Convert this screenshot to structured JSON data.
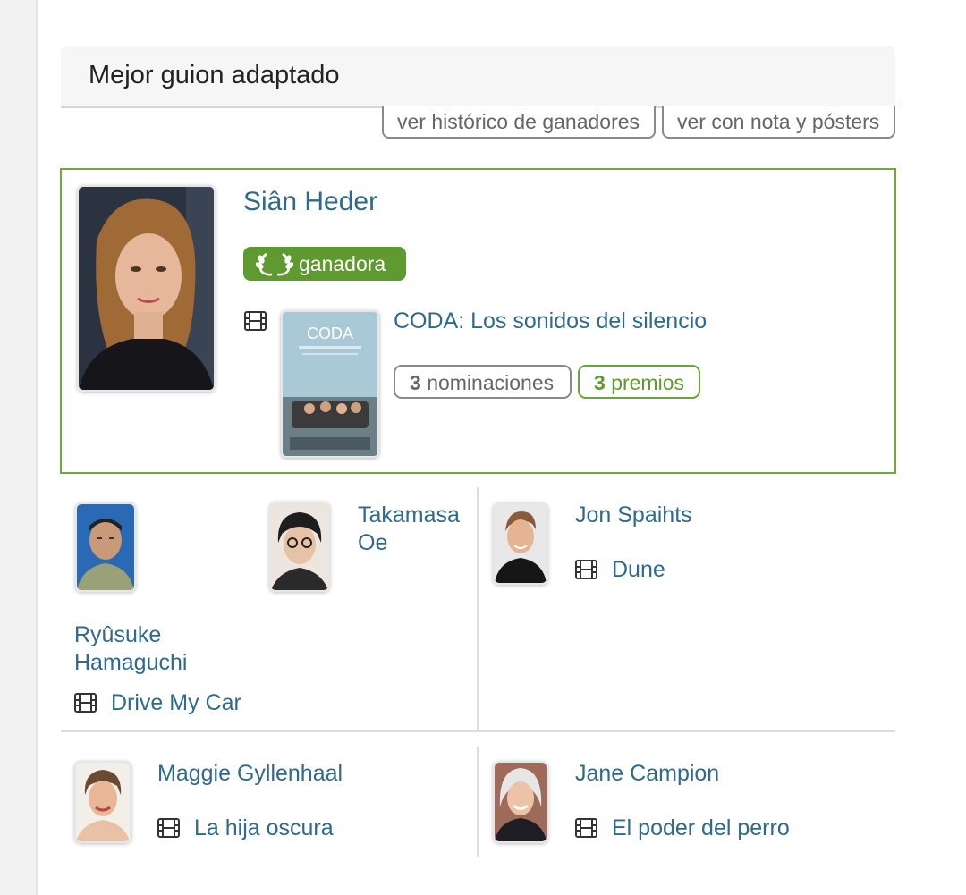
{
  "category": {
    "title": "Mejor guion adaptado",
    "history_button": "ver histórico de ganadores",
    "posters_button": "ver con nota y pósters"
  },
  "winner": {
    "name": "Siân Heder",
    "badge": "ganadora",
    "film": "CODA: Los sonidos del silencio",
    "poster_title": "CODA",
    "nominations_count": "3",
    "nominations_label": "nominaciones",
    "awards_count": "3",
    "awards_label": "premios"
  },
  "nominees": [
    {
      "names": [
        "Ryûsuke Hamaguchi",
        "Takamasa Oe"
      ],
      "film": "Drive My Car"
    },
    {
      "names": [
        "Jon Spaihts"
      ],
      "film": "Dune"
    },
    {
      "names": [
        "Maggie Gyllenhaal"
      ],
      "film": "La hija oscura"
    },
    {
      "names": [
        "Jane Campion"
      ],
      "film": "El poder del perro"
    }
  ],
  "colors": {
    "link": "#2f6a8e",
    "winner_green": "#5e9a2f",
    "winner_border": "#73a83b"
  }
}
